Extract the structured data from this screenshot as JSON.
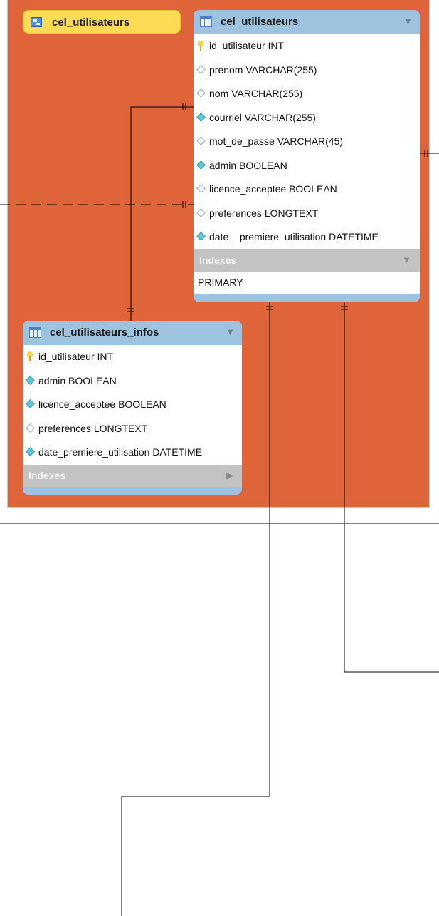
{
  "tag": {
    "label": "cel_utilisateurs"
  },
  "main_table": {
    "title": "cel_utilisateurs",
    "columns": [
      {
        "icon": "key-icon",
        "text": "id_utilisateur INT"
      },
      {
        "icon": "hollow-diamond-icon",
        "text": "prenom VARCHAR(255)"
      },
      {
        "icon": "hollow-diamond-icon",
        "text": "nom VARCHAR(255)"
      },
      {
        "icon": "filled-diamond-icon",
        "text": "courriel VARCHAR(255)"
      },
      {
        "icon": "hollow-diamond-icon",
        "text": "mot_de_passe VARCHAR(45)"
      },
      {
        "icon": "filled-diamond-icon",
        "text": "admin BOOLEAN"
      },
      {
        "icon": "hollow-diamond-icon",
        "text": "licence_acceptee BOOLEAN"
      },
      {
        "icon": "hollow-diamond-icon",
        "text": "preferences LONGTEXT"
      },
      {
        "icon": "filled-diamond-icon",
        "text": "date__premiere_utilisation DATETIME"
      }
    ],
    "indexes_label": "Indexes",
    "indexes": [
      "PRIMARY"
    ]
  },
  "infos_table": {
    "title": "cel_utilisateurs_infos",
    "columns": [
      {
        "icon": "key-icon",
        "text": "id_utilisateur INT"
      },
      {
        "icon": "filled-diamond-icon",
        "text": "admin BOOLEAN"
      },
      {
        "icon": "filled-diamond-icon",
        "text": "licence_acceptee BOOLEAN"
      },
      {
        "icon": "hollow-diamond-icon",
        "text": "preferences LONGTEXT"
      },
      {
        "icon": "filled-diamond-icon",
        "text": "date_premiere_utilisation DATETIME"
      }
    ],
    "indexes_label": "Indexes"
  },
  "colors": {
    "group_fill": "#e0643a",
    "tag_fill": "#fddb55",
    "header_blue": "#9ec3df"
  }
}
